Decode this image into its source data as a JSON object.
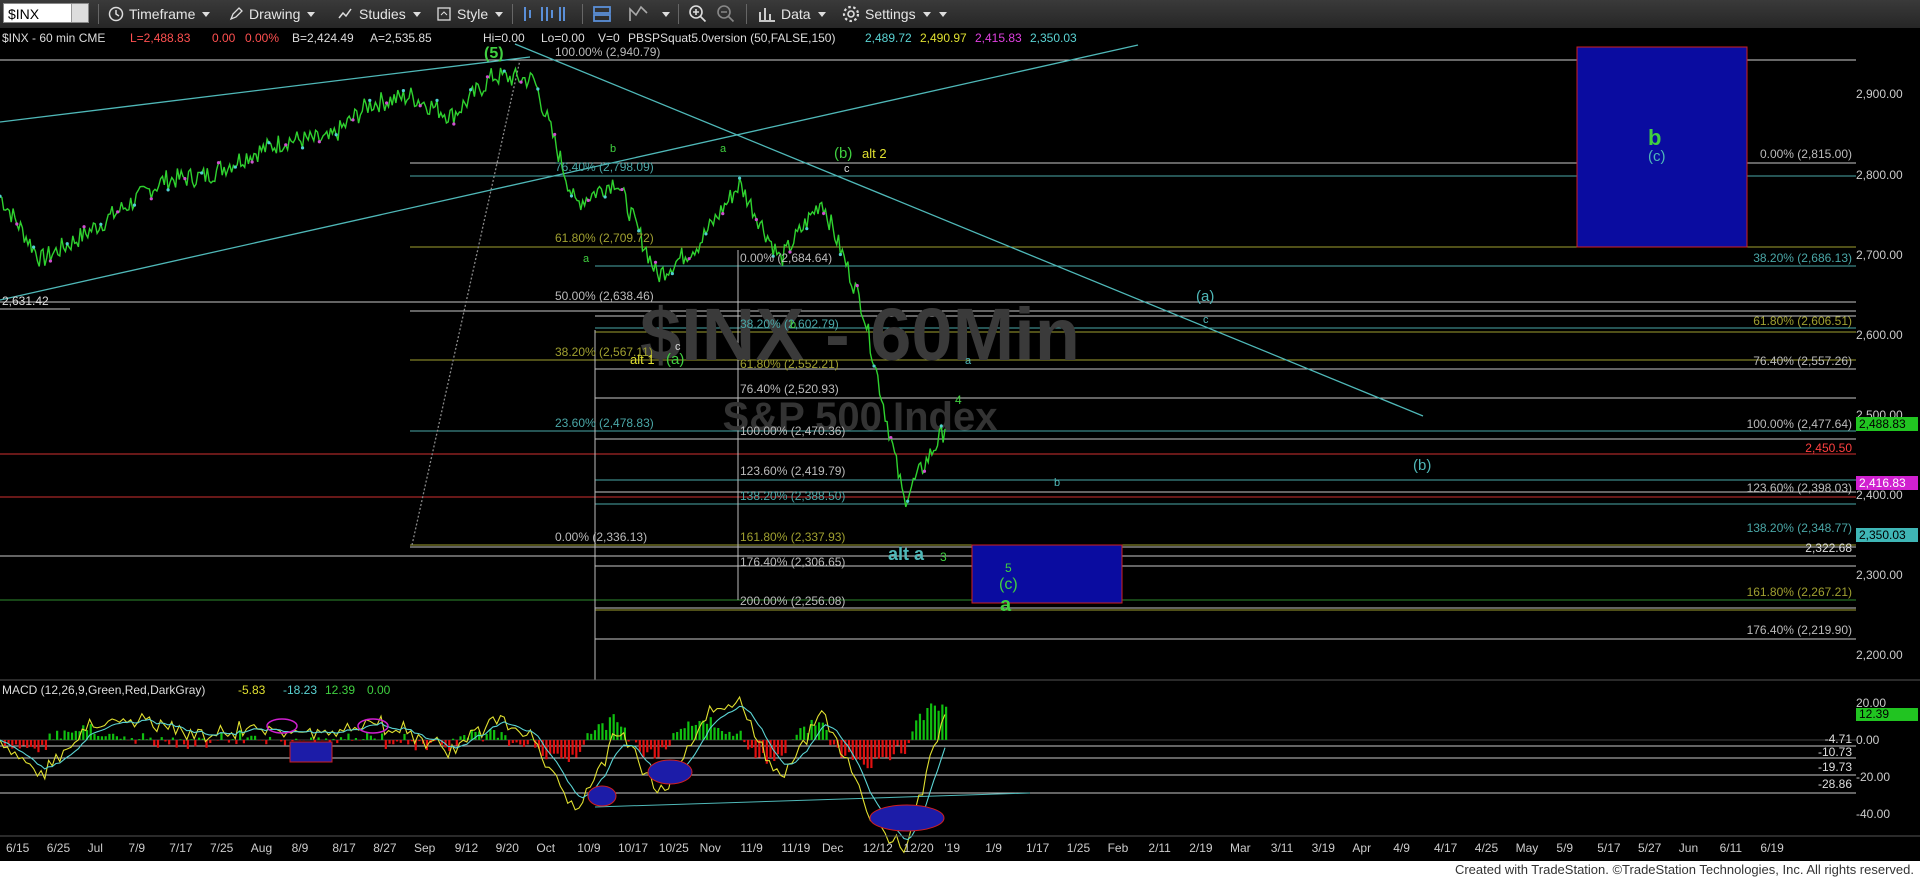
{
  "toolbar": {
    "symbol": "$INX",
    "items": [
      {
        "label": "Timeframe",
        "icon": "clock-icon"
      },
      {
        "label": "Drawing",
        "icon": "pen-icon"
      },
      {
        "label": "Studies",
        "icon": "chart-magnifier-icon"
      },
      {
        "label": "Style",
        "icon": "paint-icon"
      },
      {
        "label": "Data",
        "icon": "bars-icon"
      },
      {
        "label": "Settings",
        "icon": "gear-icon"
      }
    ],
    "colors": {
      "bg": "#2f2f2f",
      "text": "#e6e6e6"
    }
  },
  "header": {
    "symbol_label": "$INX - 60 min  CME",
    "low": "L=2,488.83",
    "change": "0.00",
    "pct": "0.00%",
    "bid": "B=2,424.49",
    "ask": "A=2,535.85",
    "hi": "Hi=0.00",
    "lo": "Lo=0.00",
    "vol": "V=0",
    "study": "PBSPSquat5.0version (50,FALSE,150)",
    "v1": "2,489.72",
    "v2": "2,490.97",
    "v3": "2,415.83",
    "v4": "2,350.03"
  },
  "watermark": {
    "line1": "$INX - 60Min",
    "line2": "S&P 500 Index"
  },
  "price_axis": {
    "ticks": [
      "2,900.00",
      "2,800.00",
      "2,700.00",
      "2,600.00",
      "2,500.00",
      "2,400.00",
      "2,300.00",
      "2,200.00"
    ],
    "last_price": "2,488.83",
    "mid_tag": "2,416.83",
    "low_tag": "2,350.03",
    "red_label": "2,450.50",
    "level_2322": "2,322.68",
    "level_2631": "2,631.42"
  },
  "fib_labels": {
    "left": [
      "100.00% (2,940.79)",
      "76.40% (2,798.09)",
      "61.80% (2,709.72)",
      "50.00% (2,638.46)",
      "38.20% (2,567.11)",
      "23.60% (2,478.83)",
      "0.00% (2,336.13)"
    ],
    "mid": [
      "0.00% (2,684.64)",
      "38.20% (2,602.79)",
      "61.80% (2,552.21)",
      "76.40% (2,520.93)",
      "100.00% (2,470.36)",
      "123.60% (2,419.79)",
      "138.20% (2,388.50)",
      "161.80% (2,337.93)",
      "176.40% (2,306.65)",
      "200.00% (2,256.08)"
    ],
    "right": [
      "0.00% (2,815.00)",
      "38.20% (2,686.13)",
      "61.80% (2,606.51)",
      "76.40% (2,557.26)",
      "100.00% (2,477.64)",
      "123.60% (2,398.03)",
      "138.20% (2,348.77)",
      "161.80% (2,267.21)",
      "176.40% (2,219.90)"
    ]
  },
  "wave_labels": {
    "b5": "(5)",
    "b_green": "(b)",
    "alt2": "alt 2",
    "alt1": "alt 1",
    "a_paren": "(a)",
    "a_teal": "(a)",
    "b_teal": "(b)",
    "c_teal": "(c)",
    "big_b": "b",
    "c5": "(c)",
    "small_a": "a",
    "alt_a": "alt a",
    "n3": "3",
    "n4": "4",
    "n5": "5",
    "sa": "a",
    "sb": "b",
    "sc": "c"
  },
  "macd": {
    "title": "MACD (12,26,9,Green,Red,DarkGray)",
    "v1": "-5.83",
    "v2": "-18.23",
    "v3": "12.39",
    "v4": "0.00",
    "ticks": [
      "20.00",
      "0.00",
      "-20.00",
      "-40.00"
    ],
    "tag": "12.39",
    "levels": [
      "-4.71",
      "-10.73",
      "-19.73",
      "-28.86"
    ]
  },
  "time_axis": {
    "labels": [
      "6/15",
      "6/25",
      "Jul",
      "7/9",
      "7/17",
      "7/25",
      "Aug",
      "8/9",
      "8/17",
      "8/27",
      "Sep",
      "9/12",
      "9/20",
      "Oct",
      "10/9",
      "10/17",
      "10/25",
      "Nov",
      "11/9",
      "11/19",
      "Dec",
      "12/12",
      "12/20",
      "'19",
      "1/9",
      "1/17",
      "1/25",
      "Feb",
      "2/11",
      "2/19",
      "Mar",
      "3/11",
      "3/19",
      "Apr",
      "4/9",
      "4/17",
      "4/25",
      "May",
      "5/9",
      "5/17",
      "5/27",
      "Jun",
      "6/11",
      "6/19"
    ]
  },
  "footer": {
    "credit": "Created with TradeStation. ©TradeStation Technologies, Inc. All rights reserved."
  },
  "chart_data": {
    "type": "line",
    "title": "$INX - 60Min",
    "subtitle": "S&P 500 Index",
    "xlabel": "",
    "ylabel": "",
    "ylim": [
      2160,
      2960
    ],
    "x": [
      "6/15",
      "6/25",
      "Jul",
      "7/9",
      "7/17",
      "7/25",
      "Aug",
      "8/9",
      "8/17",
      "8/27",
      "Sep",
      "9/12",
      "9/20",
      "Oct",
      "10/9",
      "10/17",
      "10/25",
      "Nov",
      "11/9",
      "11/19",
      "Dec",
      "12/12",
      "12/20"
    ],
    "series": [
      {
        "values": [
          2780,
          2700,
          2730,
          2765,
          2800,
          2805,
          2830,
          2850,
          2850,
          2895,
          2905,
          2880,
          2930,
          2925,
          2770,
          2800,
          2680,
          2720,
          2795,
          2700,
          2775,
          2640,
          2400
        ]
      }
    ],
    "last": 2488.83,
    "grid": false,
    "legend": "none"
  }
}
